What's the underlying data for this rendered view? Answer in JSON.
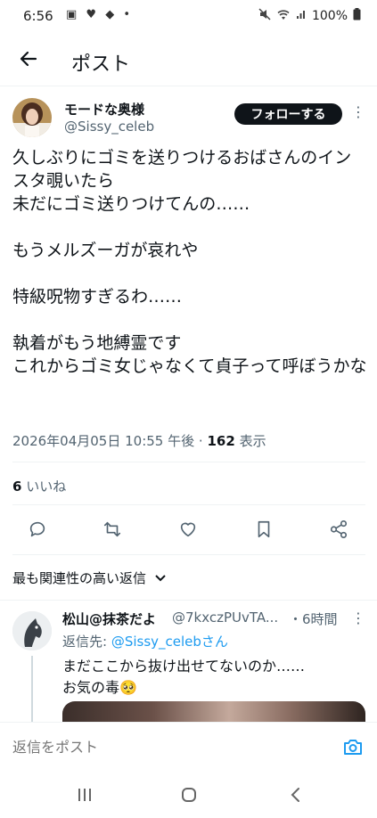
{
  "status_bar": {
    "time": "6:56",
    "left_icons": "▣ ♥ ◆ •",
    "battery": "100%"
  },
  "header": {
    "title": "ポスト"
  },
  "tweet": {
    "display_name": "モードな奥様",
    "handle": "@Sissy_celeb",
    "follow_label": "フォローする",
    "text": "久しぶりにゴミを送りつけるおばさんのインスタ覗いたら\n未だにゴミ送りつけてんの……\n\nもうメルズーガが哀れや\n\n特級呪物すぎるわ……\n\n執着がもう地縛霊です\nこれからゴミ女じゃなくて貞子って呼ぼうかな",
    "timestamp": "2026年04月05日 10:55 午後",
    "views_count": "162",
    "views_label": "表示",
    "likes_count": "6",
    "likes_label": "いいね"
  },
  "sort_label": "最も関連性の高い返信",
  "reply": {
    "display_name": "松山@抹茶だよ",
    "handle": "@7kxczPUvTA...",
    "time": "・6時間",
    "reply_to_prefix": "返信先: ",
    "reply_to_handle": "@Sissy_celebさん",
    "text": "まだここから抜け出せてないのか……\nお気の毒🥺"
  },
  "compose": {
    "placeholder": "返信をポスト"
  },
  "colors": {
    "accent": "#1d9bf0",
    "text": "#0f1419",
    "secondary": "#536471"
  }
}
